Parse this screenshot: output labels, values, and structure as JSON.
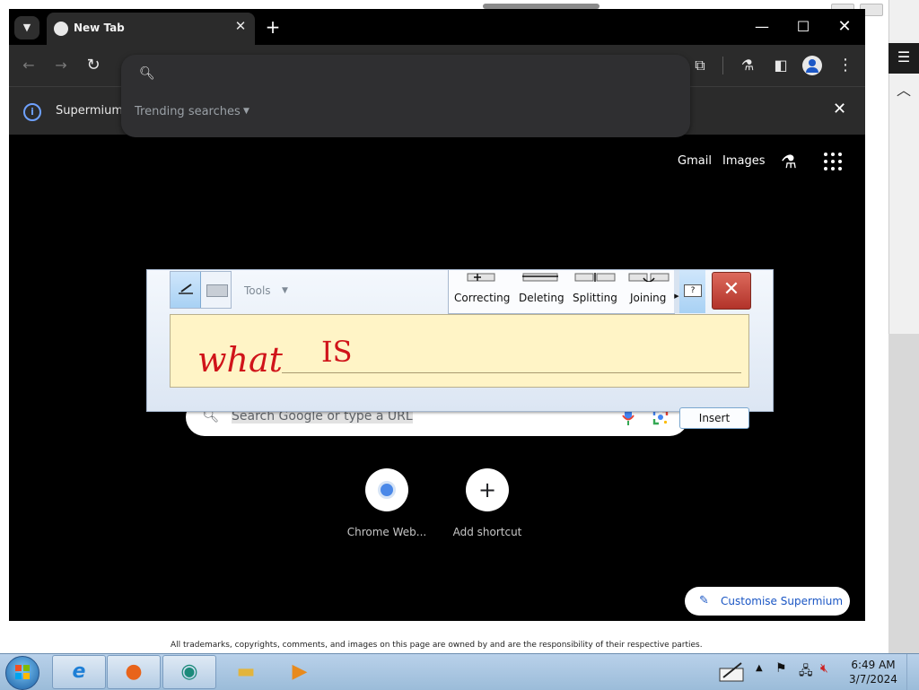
{
  "background_page": {
    "footer_text": "All trademarks, copyrights, comments, and images on this page are owned by and are the responsibility of their respective parties."
  },
  "browser": {
    "tab": {
      "title": "New Tab",
      "close": "✕"
    },
    "new_tab": "+",
    "window_controls": {
      "minimize": "—",
      "maximize": "☐",
      "close": "✕"
    },
    "infobar": {
      "text": "Supermium",
      "close": "✕"
    },
    "omnibox": {
      "trending_label": "Trending searches"
    }
  },
  "ntp": {
    "header_links": {
      "gmail": "Gmail",
      "images": "Images"
    },
    "search_placeholder": "Search Google or type a URL",
    "shortcuts": [
      {
        "label": "Chrome Web..."
      },
      {
        "label": "Add shortcut"
      }
    ],
    "customise_label": "Customise Supermium"
  },
  "tip": {
    "tools_label": "Tools",
    "gestures": {
      "correcting": "Correcting",
      "deleting": "Deleting",
      "splitting": "Splitting",
      "joining": "Joining"
    },
    "ink": {
      "word1": "what",
      "word2": "IS"
    },
    "insert_label": "Insert",
    "help_glyph": "?"
  },
  "taskbar": {
    "time": "6:49 AM",
    "date": "3/7/2024"
  },
  "colors": {
    "ink": "#d0141a",
    "accent": "#1a56c4",
    "tip_writing_bg": "#fff4c6"
  }
}
